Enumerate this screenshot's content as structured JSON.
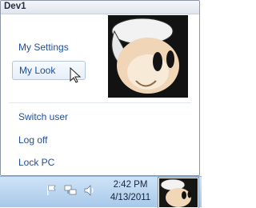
{
  "window": {
    "title": "Dev1"
  },
  "menu": {
    "items": [
      {
        "label": "My Settings"
      },
      {
        "label": "My Look"
      },
      {
        "label": "Switch user"
      },
      {
        "label": "Log off"
      },
      {
        "label": "Lock PC"
      }
    ]
  },
  "avatar": {
    "icon": "chef-cartoon-avatar"
  },
  "taskbar": {
    "time": "2:42 PM",
    "date": "4/13/2011",
    "tray_icons": [
      "flag-icon",
      "network-icon",
      "speaker-icon"
    ]
  }
}
